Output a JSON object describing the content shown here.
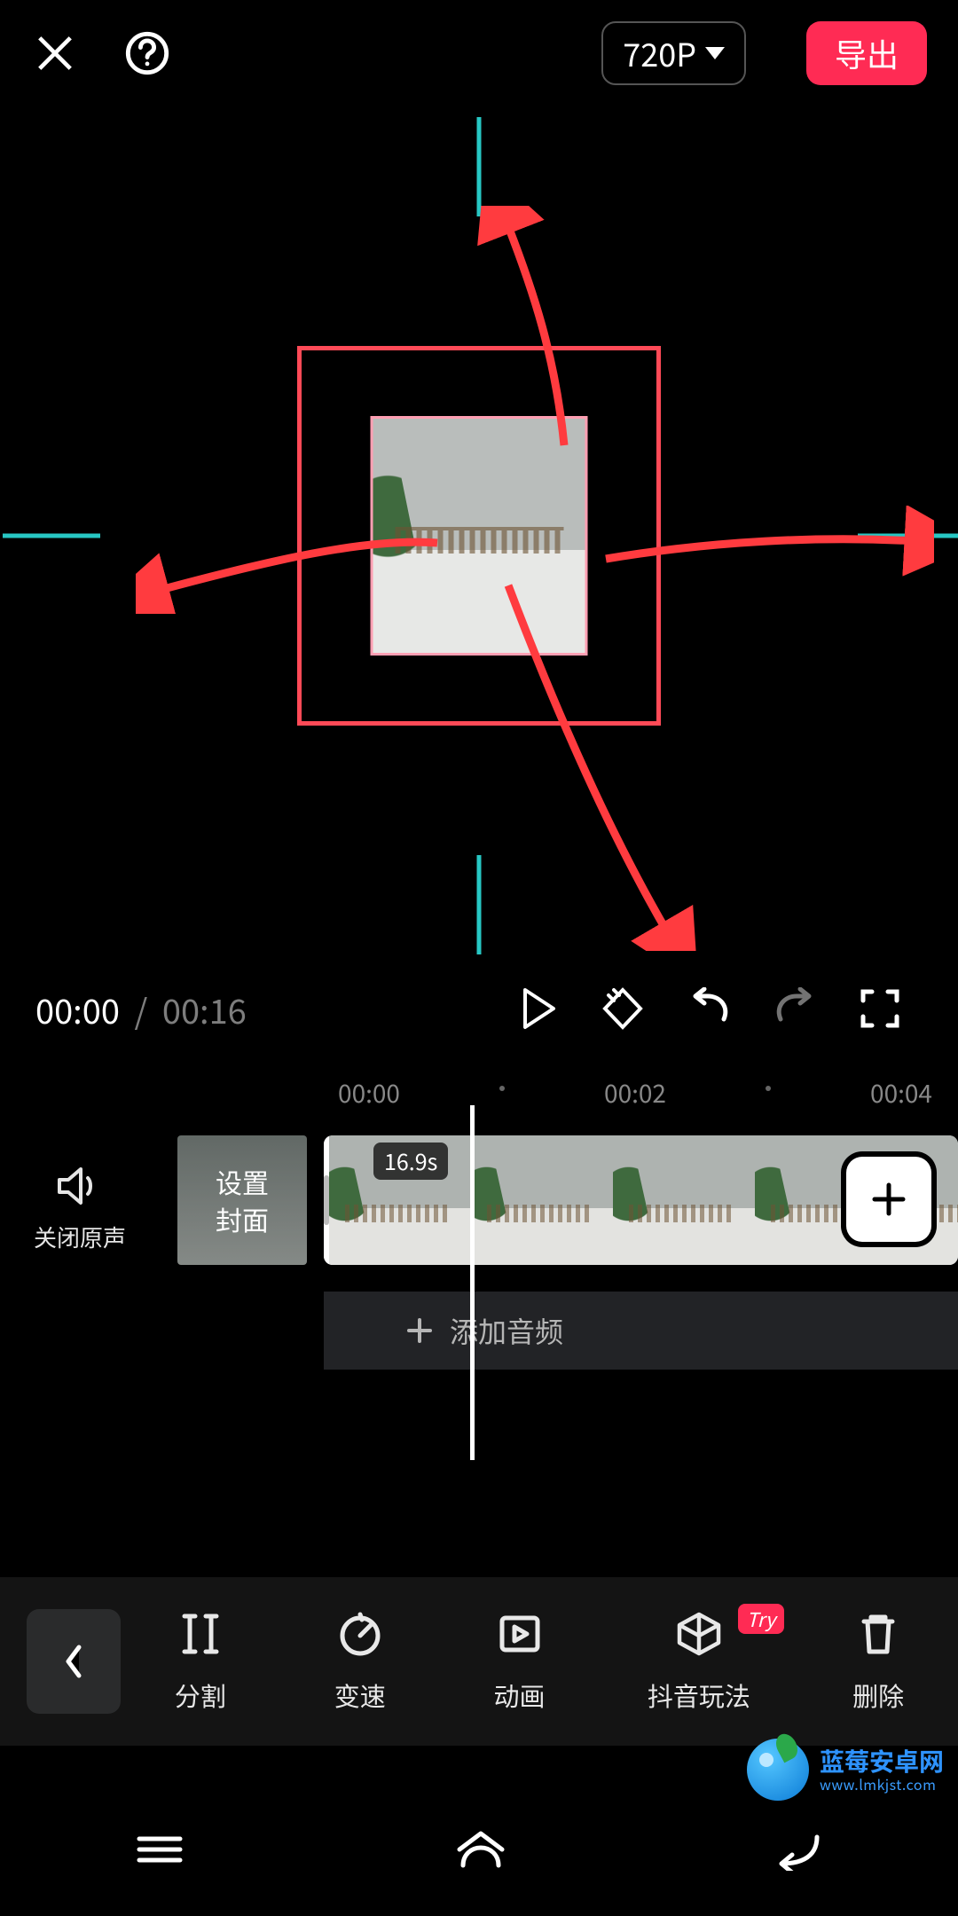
{
  "header": {
    "resolution_label": "720P",
    "export_label": "导出"
  },
  "transport": {
    "current_time": "00:00",
    "total_time": "00:16",
    "separator": "/"
  },
  "ruler": {
    "marks": [
      "00:00",
      "00:02",
      "00:04"
    ]
  },
  "timeline": {
    "mute_label": "关闭原声",
    "cover_label": "设置\n封面",
    "clip_duration_label": "16.9s",
    "add_audio_label": "添加音频"
  },
  "tools": {
    "split": "分割",
    "speed": "变速",
    "animation": "动画",
    "douyin_effect": "抖音玩法",
    "try_badge": "Try",
    "delete": "删除"
  },
  "watermark": {
    "line1": "蓝莓安卓网",
    "line2": "www.lmkjst.com"
  },
  "colors": {
    "accent": "#ff2b54",
    "guide": "#27c7c4",
    "selection": "#ff4a57"
  }
}
